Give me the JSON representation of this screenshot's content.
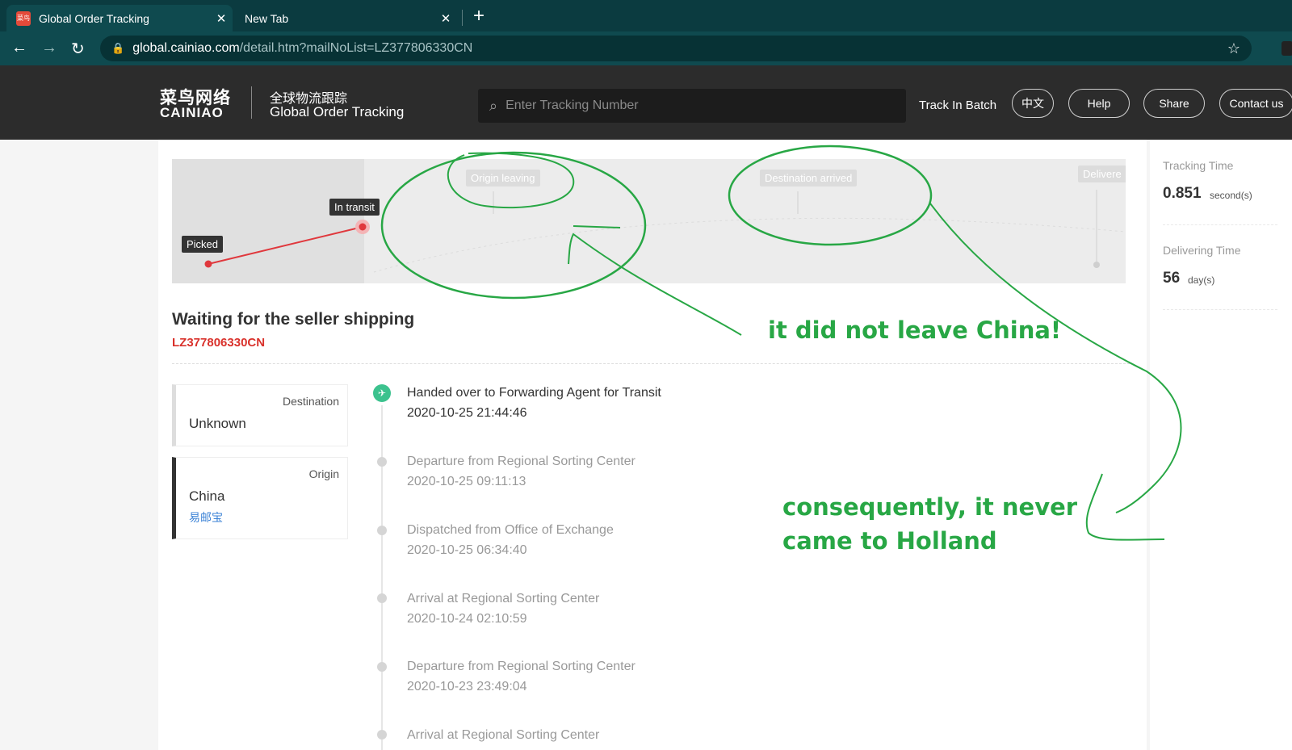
{
  "browser": {
    "tabs": [
      {
        "title": "Global Order Tracking",
        "favicon": "菜鸟",
        "active": true
      },
      {
        "title": "New Tab",
        "active": false
      }
    ],
    "url_host": "global.cainiao.com",
    "url_path": "/detail.htm?mailNoList=LZ377806330CN"
  },
  "header": {
    "logo_cn": "菜鸟网络",
    "logo_en": "CAINIAO",
    "subtitle_cn": "全球物流跟踪",
    "subtitle_en": "Global Order Tracking",
    "search_placeholder": "Enter Tracking Number",
    "track_batch": "Track In Batch",
    "buttons": {
      "lang": "中文",
      "help": "Help",
      "share": "Share",
      "contact": "Contact us"
    }
  },
  "progress": {
    "stages": [
      "Picked",
      "In transit",
      "Origin leaving",
      "Destination arrived",
      "Delivere"
    ],
    "accent_color": "#e0383d"
  },
  "shipment": {
    "status": "Waiting for the seller shipping",
    "mail_no": "LZ377806330CN",
    "destination_label": "Destination",
    "destination_value": "Unknown",
    "origin_label": "Origin",
    "origin_value": "China",
    "origin_service": "易邮宝"
  },
  "events": [
    {
      "title": "Handed over to Forwarding Agent for Transit",
      "time": "2020-10-25 21:44:46"
    },
    {
      "title": "Departure from Regional Sorting Center",
      "time": "2020-10-25 09:11:13"
    },
    {
      "title": "Dispatched from Office of Exchange",
      "time": "2020-10-25 06:34:40"
    },
    {
      "title": "Arrival at Regional Sorting Center",
      "time": "2020-10-24 02:10:59"
    },
    {
      "title": "Departure from Regional Sorting Center",
      "time": "2020-10-23 23:49:04"
    },
    {
      "title": "Arrival at Regional Sorting Center",
      "time": ""
    }
  ],
  "sidebar": {
    "tracking_time_label": "Tracking Time",
    "tracking_time_value": "0.851",
    "tracking_time_unit": "second(s)",
    "delivering_time_label": "Delivering Time",
    "delivering_time_value": "56",
    "delivering_time_unit": "day(s)"
  },
  "annotations": {
    "note1": "it did not leave China!",
    "note2_line1": "consequently, it never",
    "note2_line2": "came to Holland",
    "color": "#28a745"
  }
}
